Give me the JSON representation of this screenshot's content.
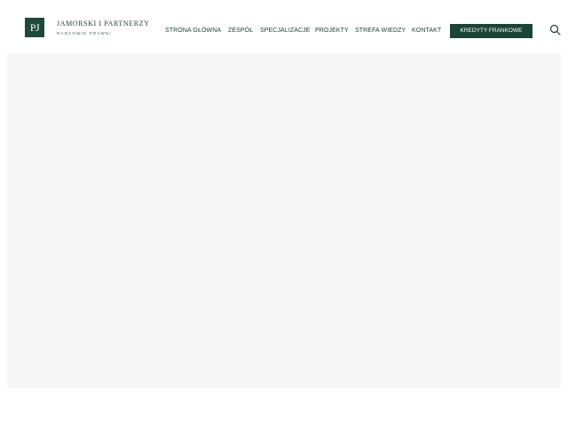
{
  "brand": {
    "logo_mark": "PJ",
    "name": "JAMORSKI I PARTNERZY",
    "tagline": "RADCOWIE PRAWNI"
  },
  "nav": {
    "items": [
      {
        "label": "STRONA GŁÓWNA"
      },
      {
        "label": "ZESPÓŁ"
      },
      {
        "label": "SPECJALIZACJE"
      },
      {
        "label": "PROJEKTY"
      },
      {
        "label": "STREFA WIEDZY"
      },
      {
        "label": "KONTAKT"
      }
    ],
    "cta_label": "KREDYTY FRANKOWE",
    "search_icon": "search-icon"
  },
  "colors": {
    "brand_green": "#1b4434",
    "hero_background": "#f6f6f6"
  }
}
